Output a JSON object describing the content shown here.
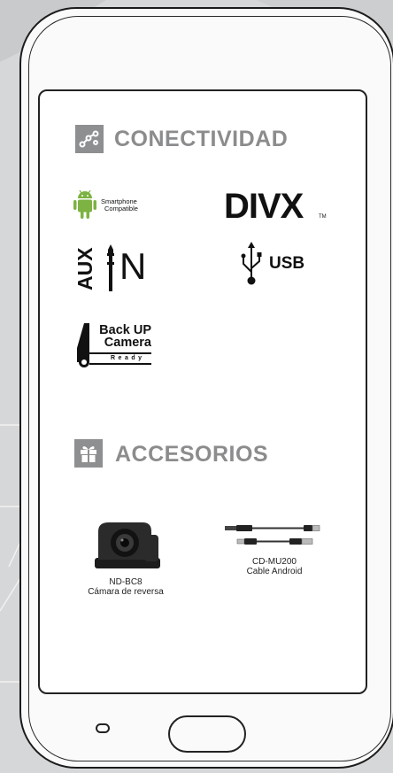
{
  "sections": {
    "connectivity": {
      "title": "CONECTIVIDAD",
      "icon": "connectivity-nodes-icon"
    },
    "accessories": {
      "title": "ACCESORIOS",
      "icon": "gift-icon"
    }
  },
  "features": {
    "smartphone": {
      "line1": "Smartphone",
      "line2": "Compatible",
      "icon": "android-icon"
    },
    "divx": {
      "label": "DIVX",
      "tm": "TM"
    },
    "aux": {
      "left": "AUX",
      "right": "N",
      "icon": "aux-jack-icon"
    },
    "usb": {
      "label": "USB",
      "icon": "usb-icon"
    },
    "backup": {
      "line1": "Back UP",
      "line2": "Camera",
      "line3": "Ready",
      "icon": "car-rear-icon"
    }
  },
  "accessories": [
    {
      "model": "ND-BC8",
      "desc": "Cámara de reversa",
      "icon": "rear-camera-image"
    },
    {
      "model": "CD-MU200",
      "desc": "Cable Android",
      "icon": "usb-cable-image"
    }
  ],
  "colors": {
    "title_gray": "#8b8c8e",
    "icon_bg": "#8e8f91",
    "android_green": "#7cb342"
  }
}
